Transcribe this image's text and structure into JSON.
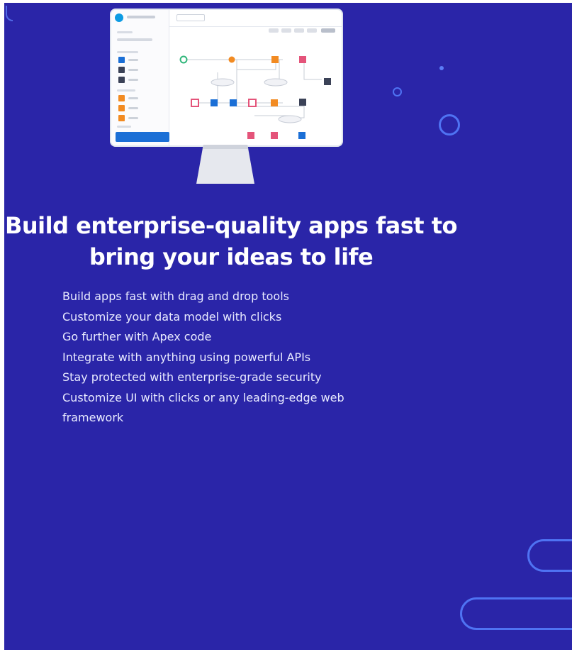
{
  "headline": "Build enterprise-quality apps fast to bring your ideas to life",
  "features": [
    "Build apps fast with drag and drop tools",
    "Customize your data model with clicks",
    "Go further with Apex code",
    "Integrate with anything using powerful APIs",
    "Stay protected with enterprise-grade security",
    "Customize UI with clicks or any leading-edge web framework"
  ],
  "colors": {
    "background": "#2a25a8",
    "accent_ring": "#4f73f3",
    "text": "#ffffff",
    "node_orange": "#f28b22",
    "node_pink": "#e4547a",
    "node_blue": "#1b6fd6",
    "node_navy": "#3b4257",
    "node_green": "#2fb67a"
  },
  "illustration": {
    "description_icon": "desktop-monitor-icon"
  }
}
